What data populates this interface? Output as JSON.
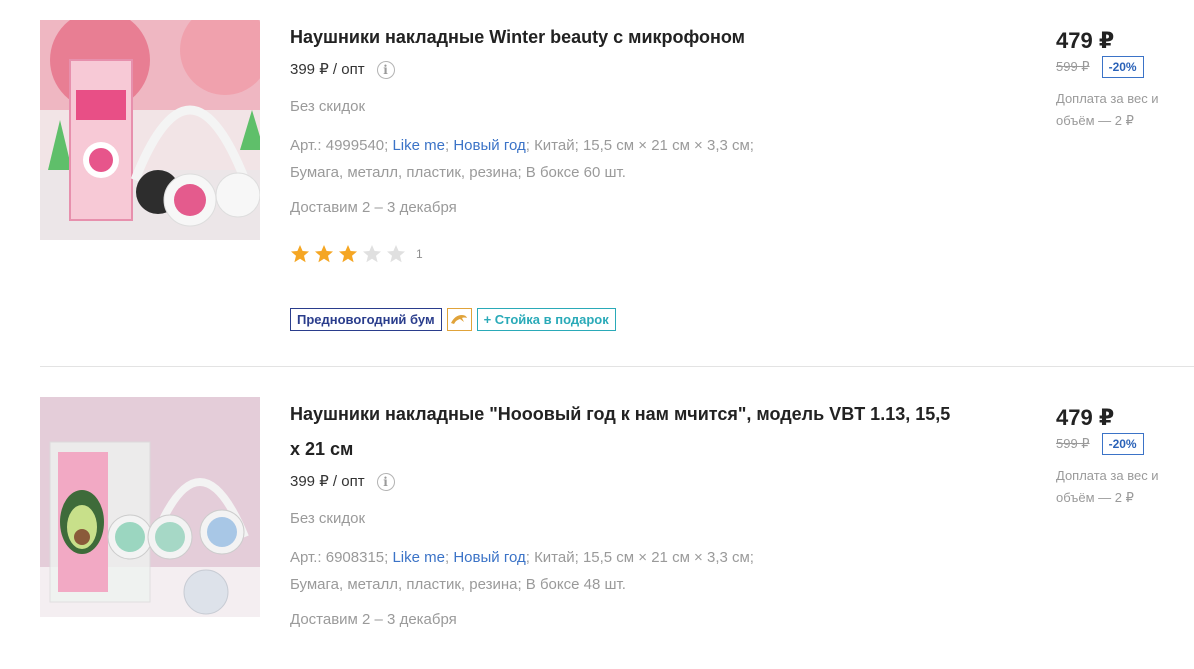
{
  "products": [
    {
      "title": "Наушники накладные Winter beauty с микрофоном",
      "opt_price": "399 ₽ / опт",
      "no_discount": "Без скидок",
      "art_label": "Арт.: 4999540;",
      "brand_link": "Like me",
      "collection_link": "Новый год",
      "props_line1_rest": "; Китай; 15,5 см × 21 см × 3,3 см;",
      "props_line2": "Бумага, металл, пластик, резина; В боксе 60 шт.",
      "delivery": "Доставим 2 – 3 декабря",
      "rating": 3,
      "rating_max": 5,
      "reviews_count": "1",
      "badges": {
        "promo": "Предновогодний бум",
        "gift": "+ Стойка в подарок",
        "icon": "dolphin-icon"
      },
      "price": "479 ₽",
      "old_price": "599 ₽",
      "discount": "-20%",
      "surcharge": "Доплата за вес и объём — 2 ₽"
    },
    {
      "title": "Наушники накладные \"Нооовый год к нам мчится\", модель VBT 1.13, 15,5 х 21 см",
      "opt_price": "399 ₽ / опт",
      "no_discount": "Без скидок",
      "art_label": "Арт.: 6908315;",
      "brand_link": "Like me",
      "collection_link": "Новый год",
      "props_line1_rest": "; Китай; 15,5 см × 21 см × 3,3 см;",
      "props_line2": "Бумага, металл, пластик, резина; В боксе 48 шт.",
      "delivery": "Доставим 2 – 3 декабря",
      "price": "479 ₽",
      "old_price": "599 ₽",
      "discount": "-20%",
      "surcharge": "Доплата за вес и объём — 2 ₽"
    }
  ],
  "colors": {
    "star_active": "#f5a623",
    "star_inactive": "#e0e0e0",
    "link": "#3b73c7",
    "badge_navy": "#2a3d8c",
    "badge_teal": "#2aaab8"
  }
}
